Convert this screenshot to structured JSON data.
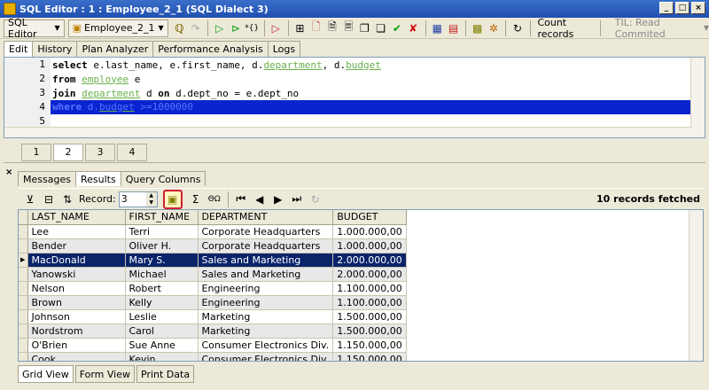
{
  "window": {
    "title": "SQL Editor : 1 : Employee_2_1 (SQL Dialect 3)"
  },
  "toolbar": {
    "sql_editor_label": "SQL Editor",
    "db_label": "Employee_2_1",
    "count_records_label": "Count records",
    "til_label": "TIL: Read Commited"
  },
  "editor_tabs": [
    "Edit",
    "History",
    "Plan Analyzer",
    "Performance Analysis",
    "Logs"
  ],
  "editor": {
    "line_numbers": [
      "1",
      "2",
      "3",
      "4",
      "5"
    ]
  },
  "page_tabs": [
    "1",
    "2",
    "3",
    "4"
  ],
  "results_tabs": [
    "Messages",
    "Results",
    "Query Columns"
  ],
  "grid_toolbar": {
    "record_label": "Record:",
    "record_value": "3",
    "fetched_text": "10 records fetched"
  },
  "grid": {
    "columns": [
      "LAST_NAME",
      "FIRST_NAME",
      "DEPARTMENT",
      "BUDGET"
    ],
    "rows": [
      [
        "Lee",
        "Terri",
        "Corporate Headquarters",
        "1.000.000,00"
      ],
      [
        "Bender",
        "Oliver H.",
        "Corporate Headquarters",
        "1.000.000,00"
      ],
      [
        "MacDonald",
        "Mary S.",
        "Sales and Marketing",
        "2.000.000,00"
      ],
      [
        "Yanowski",
        "Michael",
        "Sales and Marketing",
        "2.000.000,00"
      ],
      [
        "Nelson",
        "Robert",
        "Engineering",
        "1.100.000,00"
      ],
      [
        "Brown",
        "Kelly",
        "Engineering",
        "1.100.000,00"
      ],
      [
        "Johnson",
        "Leslie",
        "Marketing",
        "1.500.000,00"
      ],
      [
        "Nordstrom",
        "Carol",
        "Marketing",
        "1.500.000,00"
      ],
      [
        "O'Brien",
        "Sue Anne",
        "Consumer Electronics Div.",
        "1.150.000,00"
      ],
      [
        "Cook",
        "Kevin",
        "Consumer Electronics Div.",
        "1.150.000,00"
      ]
    ]
  },
  "view_tabs": [
    "Grid View",
    "Form View",
    "Print Data"
  ]
}
